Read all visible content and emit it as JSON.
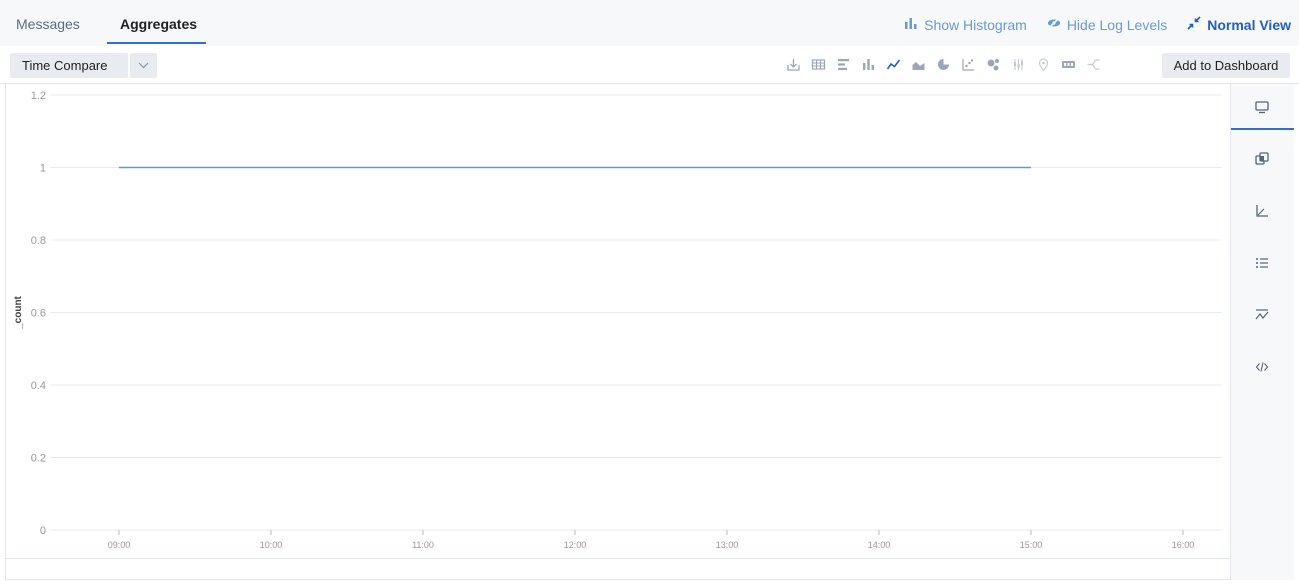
{
  "tabs": {
    "messages": "Messages",
    "aggregates": "Aggregates"
  },
  "actions": {
    "show_histogram": "Show Histogram",
    "hide_log_levels": "Hide Log Levels",
    "normal_view": "Normal View"
  },
  "toolbar": {
    "select_value": "Time Compare",
    "add_to_dashboard": "Add to Dashboard",
    "chart_icons": [
      "export-icon",
      "table-icon",
      "bar-horizontal-icon",
      "column-chart-icon",
      "line-chart-icon",
      "area-chart-icon",
      "pie-chart-icon",
      "scatter-icon",
      "bubble-icon",
      "box-plot-icon",
      "map-pin-icon",
      "single-value-icon",
      "sankey-icon"
    ]
  },
  "side_panel": [
    "display-icon",
    "overlay-icon",
    "axis-icon",
    "legend-icon",
    "trend-icon",
    "code-icon"
  ],
  "colors": {
    "accent": "#2f6fd0",
    "line": "#5b9bd5"
  },
  "chart_data": {
    "type": "line",
    "ylabel": "_count",
    "xlabel": "",
    "title": "",
    "ylim": [
      0,
      1.2
    ],
    "yticks": [
      0,
      0.2,
      0.4,
      0.6,
      0.8,
      1,
      1.2
    ],
    "ytick_labels": [
      "0",
      "0.2",
      "0.4",
      "0.6",
      "0.8",
      "1",
      "1.2"
    ],
    "xticks": [
      "09:00",
      "10:00",
      "11:00",
      "12:00",
      "13:00",
      "14:00",
      "15:00",
      "16:00"
    ],
    "series": [
      {
        "x": [
          "09:00",
          "15:00"
        ],
        "values": [
          1,
          1
        ]
      }
    ],
    "grid": true,
    "legend": "none"
  }
}
